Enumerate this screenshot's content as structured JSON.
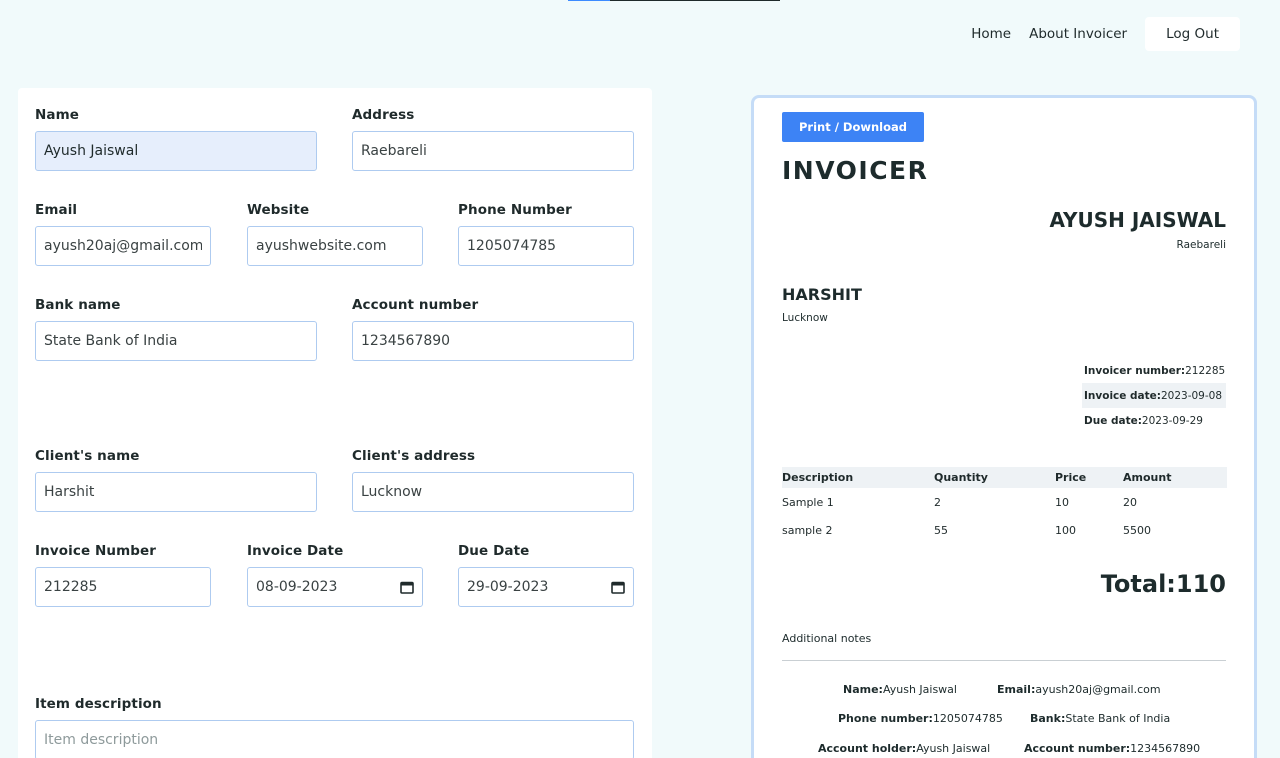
{
  "nav": {
    "home": "Home",
    "about": "About Invoicer",
    "logout": "Log Out"
  },
  "form": {
    "name": {
      "label": "Name",
      "value": "Ayush Jaiswal"
    },
    "address": {
      "label": "Address",
      "value": "Raebareli"
    },
    "email": {
      "label": "Email",
      "value": "ayush20aj@gmail.com"
    },
    "website": {
      "label": "Website",
      "value": "ayushwebsite.com"
    },
    "phone": {
      "label": "Phone Number",
      "value": "1205074785"
    },
    "bank_name": {
      "label": "Bank name",
      "value": "State Bank of India"
    },
    "account_number": {
      "label": "Account number",
      "value": "1234567890"
    },
    "client_name": {
      "label": "Client's name",
      "value": "Harshit"
    },
    "client_address": {
      "label": "Client's address",
      "value": "Lucknow"
    },
    "invoice_number": {
      "label": "Invoice Number",
      "value": "212285"
    },
    "invoice_date": {
      "label": "Invoice Date",
      "value": "08-09-2023"
    },
    "due_date": {
      "label": "Due Date",
      "value": "29-09-2023"
    },
    "item_description": {
      "label": "Item description",
      "placeholder": "Item description"
    }
  },
  "preview": {
    "print_button": "Print / Download",
    "title": "INVOICER",
    "seller_name": "AYUSH JAISWAL",
    "seller_address": "Raebareli",
    "client_name": "HARSHIT",
    "client_address": "Lucknow",
    "meta": {
      "invoice_number_label": "Invoicer number:",
      "invoice_number": "212285",
      "invoice_date_label": "Invoice date:",
      "invoice_date": "2023-09-08",
      "due_date_label": "Due date:",
      "due_date": "2023-09-29"
    },
    "table": {
      "headers": [
        "Description",
        "Quantity",
        "Price",
        "Amount"
      ],
      "rows": [
        [
          "Sample 1",
          "2",
          "10",
          "20"
        ],
        [
          "sample 2",
          "55",
          "100",
          "5500"
        ]
      ]
    },
    "total": "Total:110",
    "notes": "Additional notes",
    "footer": {
      "name_label": "Name:",
      "name": "Ayush Jaiswal",
      "email_label": "Email:",
      "email": "ayush20aj@gmail.com",
      "phone_label": "Phone number:",
      "phone": "1205074785",
      "bank_label": "Bank:",
      "bank": "State Bank of India",
      "holder_label": "Account holder:",
      "holder": "Ayush Jaiswal",
      "account_label": "Account number:",
      "account": "1234567890"
    }
  },
  "colors": {
    "background": "#f1fafb",
    "accent": "#3d83f5",
    "input_border": "#aecbf0",
    "active_input": "#e6eefc"
  }
}
